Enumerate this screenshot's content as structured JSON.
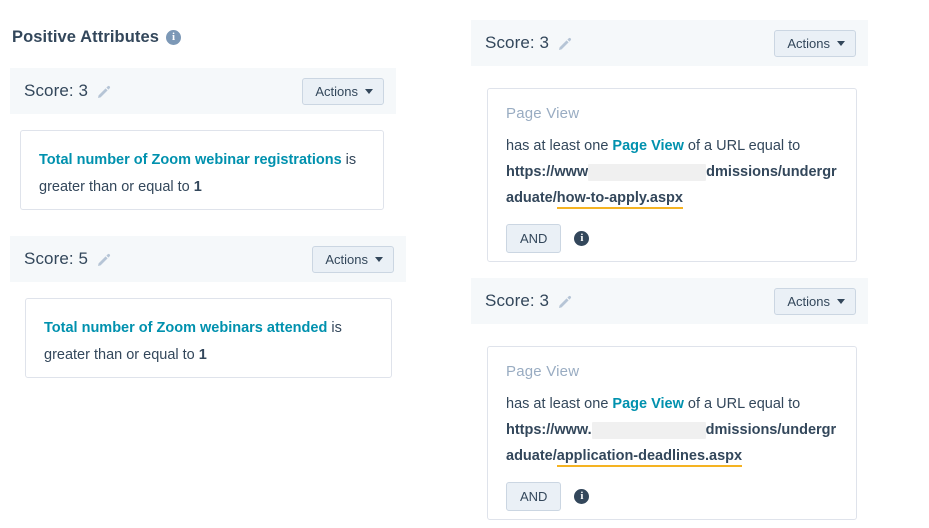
{
  "header": {
    "title": "Positive Attributes",
    "info_icon": "info-icon",
    "info_glyph": "i"
  },
  "common": {
    "actions_label": "Actions",
    "and_label": "AND",
    "score_prefix": "Score: ",
    "edit_icon": "pencil-icon",
    "caret_icon": "chevron-down-icon",
    "page_view_label": "Page View"
  },
  "left_panel": {
    "cards": [
      {
        "score_label": "Score: 3",
        "actions_label": "Actions",
        "condition": {
          "property": "Total number of Zoom webinar registrations",
          "operator_before": " is greater than or equal to ",
          "value": "1"
        }
      },
      {
        "score_label": "Score: 5",
        "actions_label": "Actions",
        "condition": {
          "property": "Total number of Zoom webinars attended",
          "operator_before": " is greater than or equal to ",
          "value": "1"
        }
      }
    ]
  },
  "right_panel": {
    "cards": [
      {
        "score_label": "Score: 3",
        "actions_label": "Actions",
        "filter": {
          "title": "Page View",
          "prefix": "has at least one ",
          "event": "Page View",
          "middle": " of a URL equal to",
          "url_start": "https://www",
          "url_redacted": true,
          "url_mid": "dmissions/undergraduate/",
          "url_highlighted": "how-to-apply.aspx",
          "and_label": "AND",
          "info_glyph": "i"
        }
      },
      {
        "score_label": "Score: 3",
        "actions_label": "Actions",
        "filter": {
          "title": "Page View",
          "prefix": "has at least one ",
          "event": "Page View",
          "middle": " of a URL equal to",
          "url_start": "https://www.",
          "url_redacted": true,
          "url_mid": "dmissions/undergraduate/",
          "url_highlighted": "application-deadlines.aspx",
          "and_label": "AND",
          "info_glyph": "i"
        }
      }
    ]
  },
  "colors": {
    "accent_teal": "#0091ae",
    "header_bg": "#f5f8fa",
    "text": "#33475b",
    "muted": "#99acc2",
    "border": "#dfe3eb",
    "button_bg": "#eaf0f6",
    "highlight_underline": "#f5b322",
    "redaction": "#f0f0f0"
  }
}
